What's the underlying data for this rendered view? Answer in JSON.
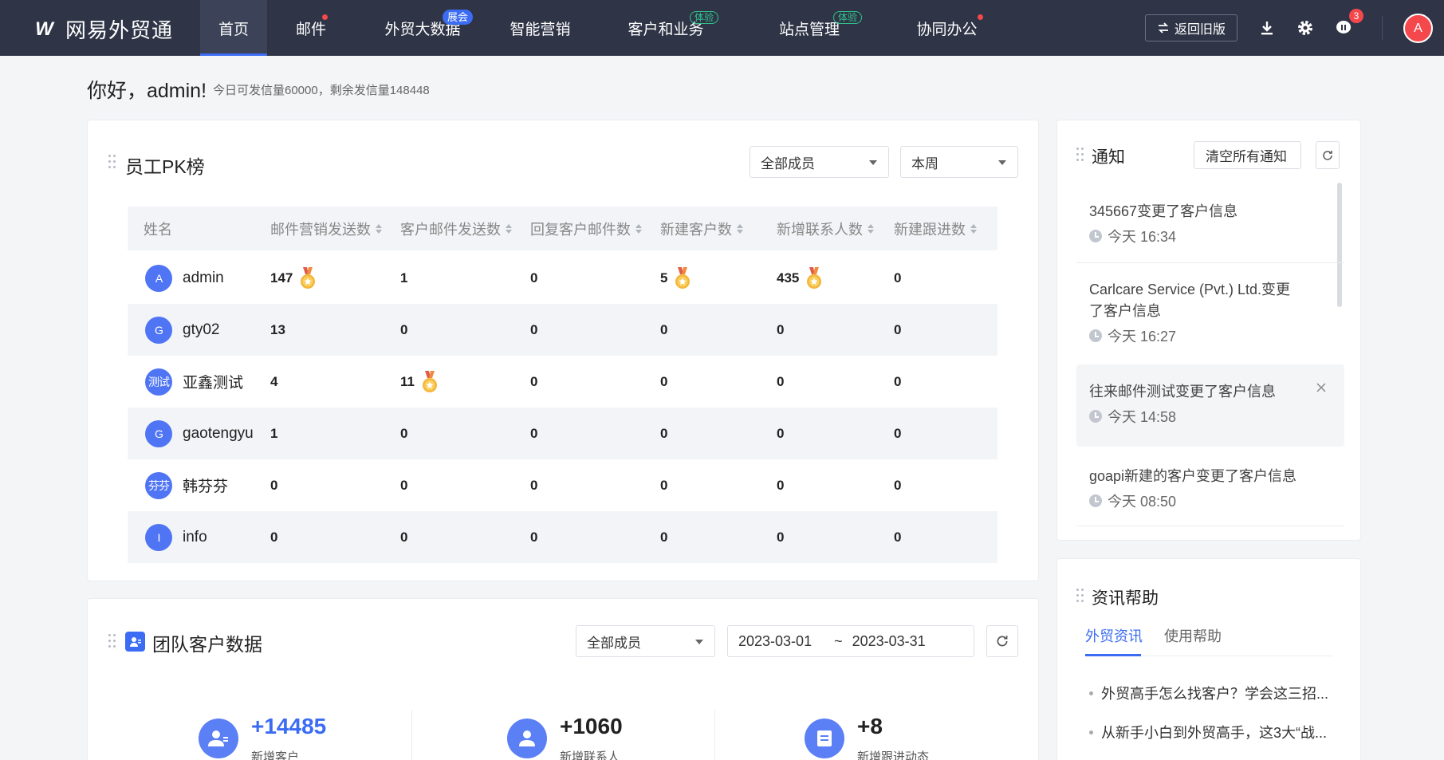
{
  "app": {
    "logo_text": "网易外贸通",
    "logo_mark": "W"
  },
  "nav": {
    "items": [
      {
        "label": "首页"
      },
      {
        "label": "邮件"
      },
      {
        "label": "外贸大数据",
        "badge": "展会"
      },
      {
        "label": "智能营销"
      },
      {
        "label": "客户和业务",
        "badge": "体验"
      },
      {
        "label": "站点管理",
        "badge": "体验"
      },
      {
        "label": "协同办公"
      }
    ],
    "old_version": "返回旧版",
    "msg_count": "3",
    "avatar": "A"
  },
  "greeting": {
    "title": "你好，admin!",
    "sub": "今日可发信量60000，剩余发信量148448"
  },
  "pk": {
    "title": "员工PK榜",
    "member_filter": "全部成员",
    "period_filter": "本周",
    "columns": [
      "姓名",
      "邮件营销发送数",
      "客户邮件发送数",
      "回复客户邮件数",
      "新建客户数",
      "新增联系人数",
      "新建跟进数"
    ],
    "rows": [
      {
        "avatar": "A",
        "name": "admin",
        "v": [
          "147",
          "1",
          "0",
          "5",
          "435",
          "0"
        ]
      },
      {
        "avatar": "G",
        "name": "gty02",
        "v": [
          "13",
          "0",
          "0",
          "0",
          "0",
          "0"
        ]
      },
      {
        "avatar": "测试",
        "name": "亚鑫测试",
        "v": [
          "4",
          "11",
          "0",
          "0",
          "0",
          "0"
        ]
      },
      {
        "avatar": "G",
        "name": "gaotengyu",
        "v": [
          "1",
          "0",
          "0",
          "0",
          "0",
          "0"
        ]
      },
      {
        "avatar": "芬芬",
        "name": "韩芬芬",
        "v": [
          "0",
          "0",
          "0",
          "0",
          "0",
          "0"
        ]
      },
      {
        "avatar": "I",
        "name": "info",
        "v": [
          "0",
          "0",
          "0",
          "0",
          "0",
          "0"
        ]
      }
    ]
  },
  "notice": {
    "title": "通知",
    "clear_btn": "清空所有通知",
    "items": [
      {
        "text": "345667变更了客户信息",
        "time": "今天 16:34"
      },
      {
        "text1": "Carlcare Service (Pvt.) Ltd.变更",
        "text2": "了客户信息",
        "time": "今天 16:27"
      },
      {
        "text": "往来邮件测试变更了客户信息",
        "time": "今天 14:58"
      },
      {
        "text": "goapi新建的客户变更了客户信息",
        "time": "今天 08:50"
      }
    ]
  },
  "team": {
    "title": "团队客户数据",
    "member_filter": "全部成员",
    "date_start": "2023-03-01",
    "date_sep": "~",
    "date_end": "2023-03-31",
    "stats": [
      {
        "value": "+14485",
        "label": "新增客户"
      },
      {
        "value": "+1060",
        "label": "新增联系人"
      },
      {
        "value": "+8",
        "label": "新增跟进动态"
      }
    ]
  },
  "help": {
    "title": "资讯帮助",
    "tabs": [
      "外贸资讯",
      "使用帮助"
    ],
    "articles": [
      "外贸高手怎么找客户？学会这三招...",
      "从新手小白到外贸高手，这3大“战..."
    ]
  },
  "colors": {
    "nav_bg": "#2f3547",
    "accent": "#3b6cf3",
    "badge_red": "#f5484c",
    "avatar_blue": "#4f75f5"
  }
}
